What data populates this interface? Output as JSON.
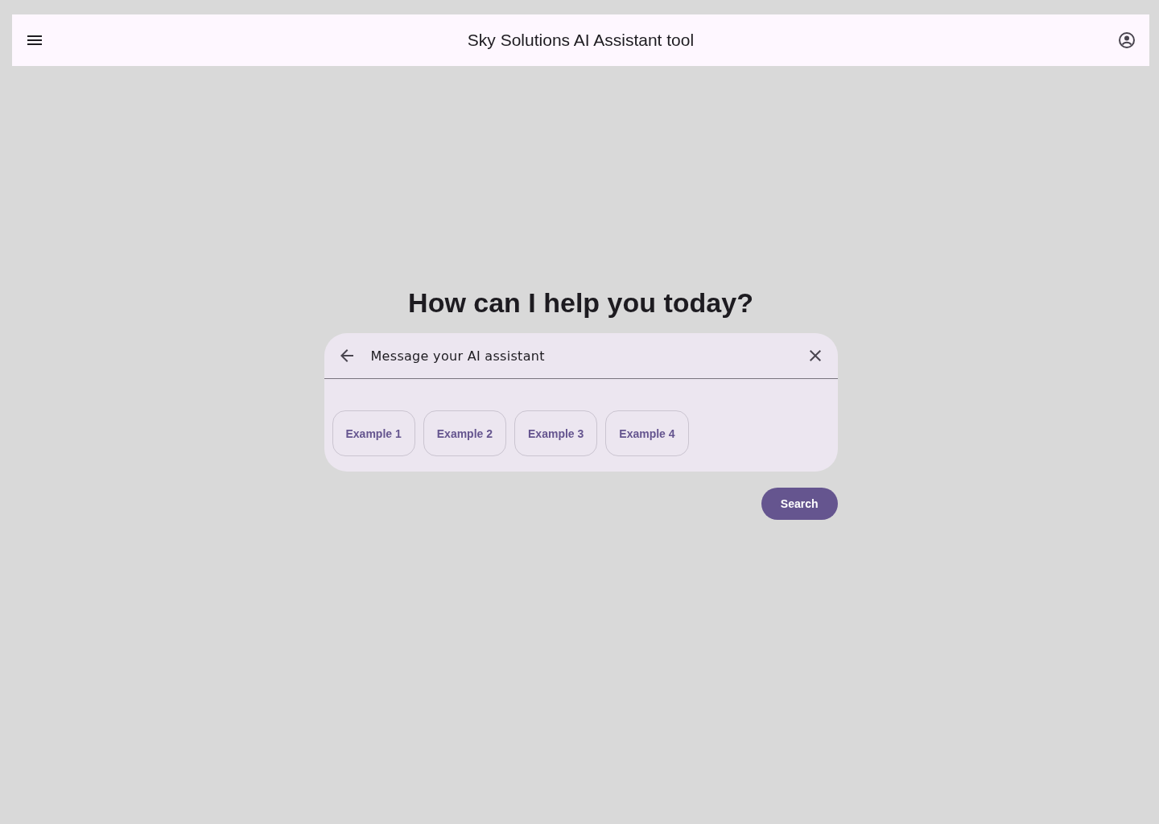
{
  "app_bar": {
    "title": "Sky Solutions AI Assistant tool"
  },
  "heading": "How can I help you today?",
  "search": {
    "value": "Message your AI assistant"
  },
  "suggestions": [
    {
      "label": "Example 1"
    },
    {
      "label": "Example 2"
    },
    {
      "label": "Example 3"
    },
    {
      "label": "Example 4"
    }
  ],
  "submit_button": "Search"
}
